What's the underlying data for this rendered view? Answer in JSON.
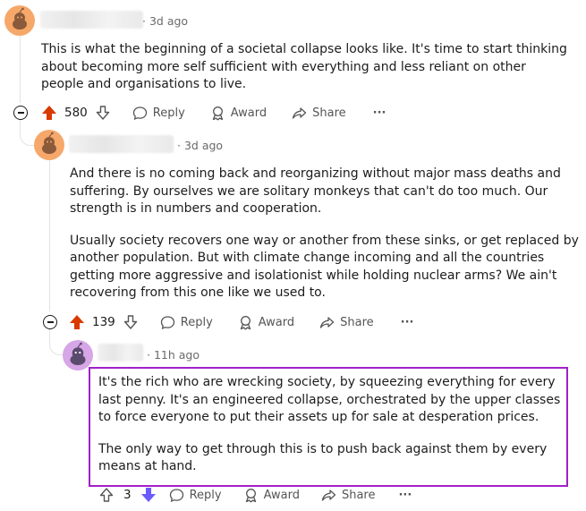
{
  "comments": [
    {
      "time": "3d ago",
      "paragraphs": [
        "This is what the beginning of a societal collapse looks like. It's time to start thinking about becoming more self sufficient with everything and less reliant on other people and organisations to live."
      ],
      "votes": "580",
      "reply_label": "Reply",
      "award_label": "Award",
      "share_label": "Share",
      "more_label": "···"
    },
    {
      "time": "3d ago",
      "paragraphs": [
        "And there is no coming back and reorganizing without major mass deaths and suffering. By ourselves we are solitary monkeys that can't do too much. Our strength is in numbers and cooperation.",
        "Usually society recovers one way or another from these sinks, or get replaced by another population. But with climate change incoming and all the countries getting more aggressive and isolationist while holding nuclear arms? We ain't recovering from this one like we used to."
      ],
      "votes": "139",
      "reply_label": "Reply",
      "award_label": "Award",
      "share_label": "Share",
      "more_label": "···"
    },
    {
      "time": "11h ago",
      "paragraphs": [
        "It's the rich who are wrecking society, by squeezing everything for every last penny. It's an engineered collapse, orchestrated by the upper classes to force everyone to put their assets up for sale at desperation prices.",
        "The only way to get through this is to push back against them by every means at hand."
      ],
      "votes": "3",
      "reply_label": "Reply",
      "award_label": "Award",
      "share_label": "Share",
      "more_label": "···"
    }
  ],
  "colors": {
    "upvote_active": "#d93a00",
    "downvote_active": "#6a5cff",
    "highlight": "#a21fc7",
    "avatar_orange": "#f6a86a",
    "avatar_purple": "#d7a6e6"
  },
  "icons": [
    "snoo-avatar-icon",
    "upvote-icon",
    "downvote-icon",
    "reply-icon",
    "award-icon",
    "share-icon",
    "collapse-icon"
  ]
}
